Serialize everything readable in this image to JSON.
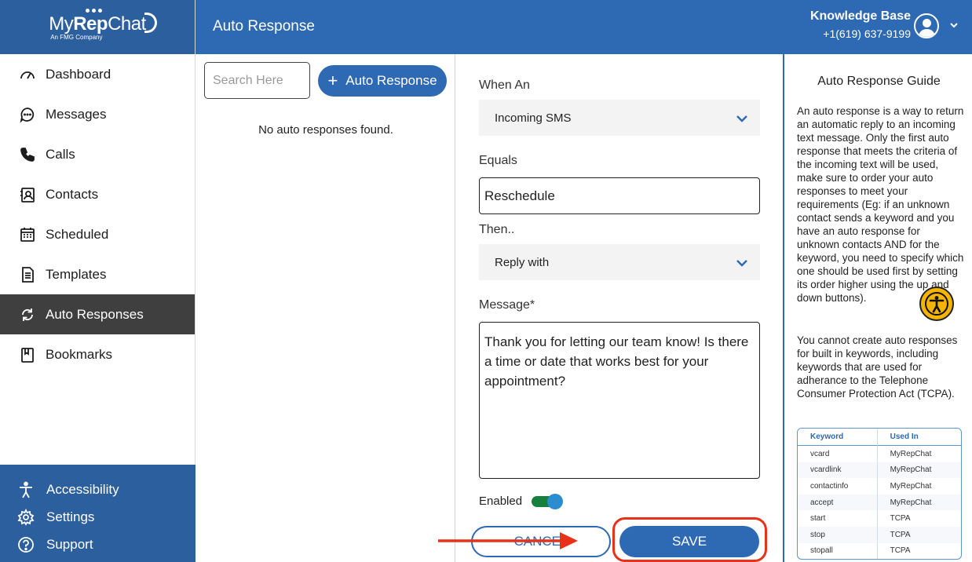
{
  "brand": {
    "name_light": "My",
    "name_bold": "Rep",
    "name_tail": "Chat",
    "tagline": "An FMG Company"
  },
  "sidebar": {
    "items": [
      {
        "label": "Dashboard",
        "icon": "speedometer-icon"
      },
      {
        "label": "Messages",
        "icon": "chat-bubble-icon"
      },
      {
        "label": "Calls",
        "icon": "phone-icon"
      },
      {
        "label": "Contacts",
        "icon": "contact-card-icon"
      },
      {
        "label": "Scheduled",
        "icon": "calendar-icon"
      },
      {
        "label": "Templates",
        "icon": "document-icon"
      },
      {
        "label": "Auto Responses",
        "icon": "refresh-icon",
        "active": true
      },
      {
        "label": "Bookmarks",
        "icon": "bookmark-icon"
      }
    ],
    "bottom": [
      {
        "label": "Accessibility",
        "icon": "accessibility-icon"
      },
      {
        "label": "Settings",
        "icon": "gear-icon"
      },
      {
        "label": "Support",
        "icon": "question-icon"
      }
    ]
  },
  "header": {
    "title": "Auto Response",
    "account_name": "Knowledge Base",
    "account_phone": "+1(619) 637-9199"
  },
  "list": {
    "search_placeholder": "Search Here",
    "add_label": "Auto Response",
    "empty_text": "No auto responses found."
  },
  "form": {
    "when_label": "When An",
    "when_value": "Incoming SMS",
    "equals_label": "Equals",
    "equals_value": "Reschedule",
    "then_label": "Then..",
    "then_value": "Reply with",
    "message_label": "Message*",
    "message_value": "Thank you for letting our team know! Is there a time or date that works best for your appointment?",
    "enabled_label": "Enabled",
    "enabled": true,
    "cancel_label": "CANCEL",
    "save_label": "SAVE"
  },
  "guide": {
    "title": "Auto Response Guide",
    "p1": "An auto response is a way to return an automatic reply to an incoming text message. Only the first auto response that meets the criteria of the incoming text will be used, make sure to order your auto responses to meet your requirements (Eg: if an unknown contact sends a keyword and you have an auto response for unknown contacts AND for the keyword, you need to specify which one should be used first by setting its order higher using the up and down buttons).",
    "p2": "You cannot create auto responses for built in keywords, including keywords that are used for adherance to the Telephone Consumer Protection Act (TCPA).",
    "table": {
      "headers": [
        "Keyword",
        "Used In"
      ],
      "rows": [
        [
          "vcard",
          "MyRepChat"
        ],
        [
          "vcardlink",
          "MyRepChat"
        ],
        [
          "contactinfo",
          "MyRepChat"
        ],
        [
          "accept",
          "MyRepChat"
        ],
        [
          "start",
          "TCPA"
        ],
        [
          "stop",
          "TCPA"
        ],
        [
          "stopall",
          "TCPA"
        ]
      ]
    }
  },
  "colors": {
    "primary": "#2e69b3",
    "sidebar_active": "#3f3f3f",
    "highlight": "#e8311a",
    "toggle_on": "#16803c"
  }
}
